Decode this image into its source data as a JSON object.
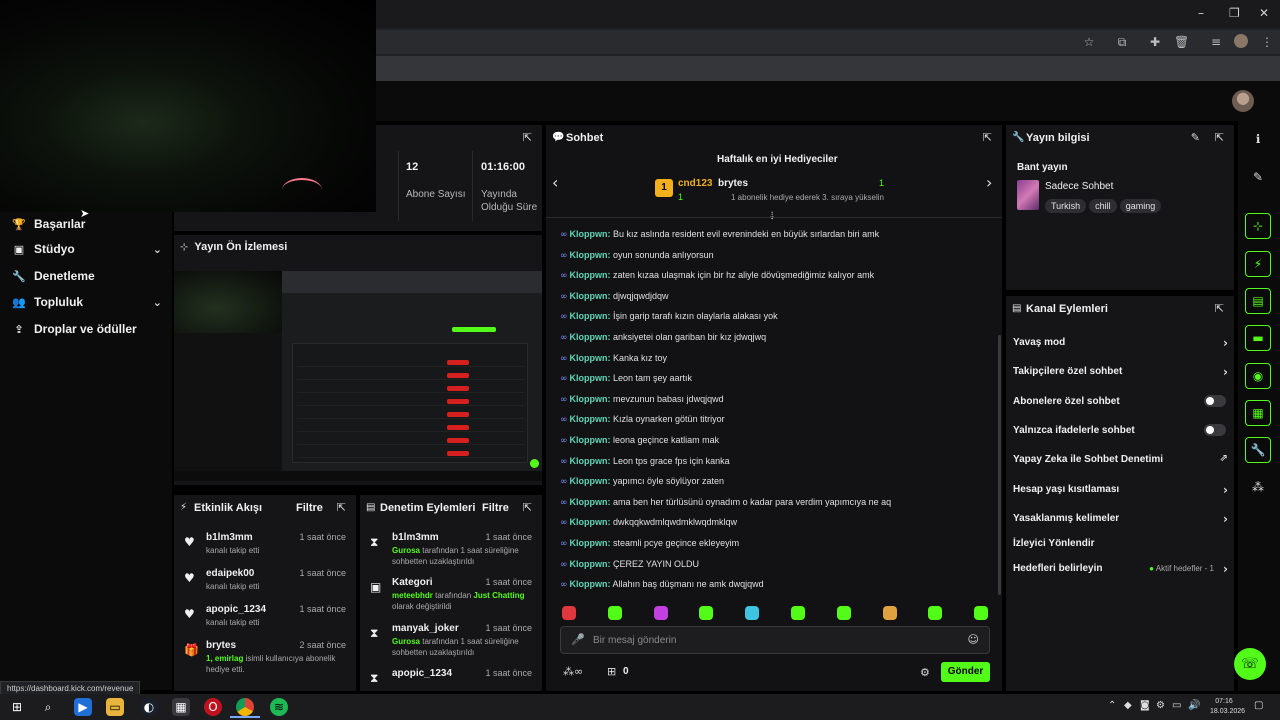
{
  "browser": {
    "window_controls": [
      "–",
      "❐",
      "✕"
    ],
    "toolbar_icons": [
      "star-icon",
      "extensions-icon",
      "puzzle-icon",
      "trash-icon",
      "menu-icon"
    ]
  },
  "sidebar": {
    "items": [
      {
        "label": "Başarılar",
        "icon": "trophy-icon",
        "chevron": false
      },
      {
        "label": "Stüdyo",
        "icon": "studio-icon",
        "chevron": true
      },
      {
        "label": "Denetleme",
        "icon": "wrench-icon",
        "chevron": false
      },
      {
        "label": "Topluluk",
        "icon": "community-icon",
        "chevron": true
      },
      {
        "label": "Droplar ve ödüller",
        "icon": "drops-icon",
        "chevron": false
      }
    ]
  },
  "stats": {
    "followers_value": "12",
    "followers_label": "Abone Sayısı",
    "duration_value": "01:16:00",
    "duration_label": "Yayında Olduğu Süre"
  },
  "preview": {
    "title": "Yayın Ön İzlemesi"
  },
  "activity": {
    "title": "Etkinlik Akışı",
    "filter": "Filtre",
    "items": [
      {
        "icon": "heart-icon",
        "name": "b1lm3mm",
        "time": "1 saat önce",
        "desc": "kanalı takip etti"
      },
      {
        "icon": "heart-icon",
        "name": "edaipek00",
        "time": "1 saat önce",
        "desc": "kanalı takip etti"
      },
      {
        "icon": "heart-icon",
        "name": "apopic_1234",
        "time": "1 saat önce",
        "desc": "kanalı takip etti"
      },
      {
        "icon": "gift-icon",
        "name": "brytes",
        "time": "2 saat önce",
        "desc_green": "1, emirlag",
        "desc": " isimli kullanıcıya abonelik hediye etti."
      }
    ]
  },
  "moderation": {
    "title": "Denetim Eylemleri",
    "filter": "Filtre",
    "items": [
      {
        "icon": "hourglass-icon",
        "name": "b1lm3mm",
        "time": "1 saat önce",
        "desc_green": "Gurosa",
        "desc": " tarafından 1 saat süreliğine sohbetten uzaklaştırıldı"
      },
      {
        "icon": "category-icon",
        "name": "Kategori",
        "time": "1 saat önce",
        "desc_green": "meteebhdr",
        "desc": " tarafından ",
        "desc_green2": "Just Chatting",
        "desc2": " olarak değiştirildi"
      },
      {
        "icon": "hourglass-icon",
        "name": "manyak_joker",
        "time": "1 saat önce",
        "desc_green": "Gurosa",
        "desc": " tarafından 1 saat süreliğine sohbetten uzaklaştırıldı"
      },
      {
        "icon": "hourglass-icon",
        "name": "apopic_1234",
        "time": "1 saat önce"
      }
    ]
  },
  "chat": {
    "title": "Sohbet",
    "gifters_title": "Haftalık en iyi Hediyeciler",
    "gifter1_name": "cnd123",
    "gifter1_count": "1",
    "gifter2_name": "brytes",
    "gifter2_count": "1",
    "gifter_note": "1 abonelik hediye ederek 3. sıraya yükselin",
    "messages": [
      {
        "user": "Kloppwn:",
        "text": "Bu kız aslında resident evil evrenindeki en büyük sırlardan biri amk"
      },
      {
        "user": "Kloppwn:",
        "text": "oyun sonunda anlıyorsun"
      },
      {
        "user": "Kloppwn:",
        "text": "zaten kızaa ulaşmak için bir hz aliyle dövüşmediğimiz kalıyor amk"
      },
      {
        "user": "Kloppwn:",
        "text": "djwqjqwdjdqw"
      },
      {
        "user": "Kloppwn:",
        "text": "İşin garip tarafı kızın olaylarla alakası yok"
      },
      {
        "user": "Kloppwn:",
        "text": "anksiyetei olan gariban bir kız jdwqjwq"
      },
      {
        "user": "Kloppwn:",
        "text": "Kanka kız toy"
      },
      {
        "user": "Kloppwn:",
        "text": "Leon tam şey aartık"
      },
      {
        "user": "Kloppwn:",
        "text": "mevzunun babası jdwqjqwd"
      },
      {
        "user": "Kloppwn:",
        "text": "Kızla oynarken götün titriyor"
      },
      {
        "user": "Kloppwn:",
        "text": "leona geçince katliam mak"
      },
      {
        "user": "Kloppwn:",
        "text": "Leon tps grace fps için kanka"
      },
      {
        "user": "Kloppwn:",
        "text": "yapımcı öyle söylüyor zaten"
      },
      {
        "user": "Kloppwn:",
        "text": "ama ben her türlüsünü oynadım o kadar para verdim yapımcıya ne aq"
      },
      {
        "user": "Kloppwn:",
        "text": "dwkqqkwdmlqwdmklwqdmklqw"
      },
      {
        "user": "Kloppwn:",
        "text": "steamli pcye geçince ekleyeyim"
      },
      {
        "user": "Kloppwn:",
        "text": "ÇEREZ YAYIN OLDU"
      },
      {
        "user": "Kloppwn:",
        "text": "Allahın baş düşmanı ne amk dwqjqwd"
      }
    ],
    "emote_colors": [
      "#e0383e",
      "#53fc18",
      "#c43fe0",
      "#53fc18",
      "#3ec4e0",
      "#53fc18",
      "#53fc18",
      "#e0a23e",
      "#53fc18",
      "#53fc18"
    ],
    "input_placeholder": "Bir mesaj gönderin",
    "loop_count": "0",
    "send_label": "Gönder"
  },
  "stream_info": {
    "title": "Yayın bilgisi",
    "stream_title": "Bant yayın",
    "category": "Sadece Sohbet",
    "tags": [
      "Turkish",
      "chill",
      "gaming"
    ]
  },
  "channel_actions": {
    "title": "Kanal Eylemleri",
    "rows": [
      {
        "label": "Yavaş mod",
        "control": "chevron"
      },
      {
        "label": "Takipçilere özel sohbet",
        "control": "chevron"
      },
      {
        "label": "Abonelere özel sohbet",
        "control": "toggle"
      },
      {
        "label": "Yalnızca ifadelerle sohbet",
        "control": "toggle"
      },
      {
        "label": "Yapay Zeka ile Sohbet Denetimi",
        "control": "external"
      },
      {
        "label": "Hesap yaşı kısıtlaması",
        "control": "chevron"
      },
      {
        "label": "Yasaklanmış kelimeler",
        "control": "chevron"
      },
      {
        "label": "İzleyici Yönlendir",
        "control": "none"
      },
      {
        "label": "Hedefleri belirleyin",
        "control": "chevron"
      }
    ],
    "goals_status": "Aktif hedefler - 1"
  },
  "status_bar": {
    "url": "https://dashboard.kick.com/revenue"
  },
  "taskbar": {
    "time": "07:16",
    "date": "18.03.2026",
    "apps": [
      "windows-icon",
      "search-icon",
      "cortana-icon",
      "files-icon",
      "steam-icon",
      "calculator-icon",
      "opera-icon",
      "chrome-icon",
      "spotify-icon"
    ]
  },
  "colors": {
    "accent": "#53fc18",
    "user": "#5fd6b6",
    "danger": "#d62020"
  }
}
